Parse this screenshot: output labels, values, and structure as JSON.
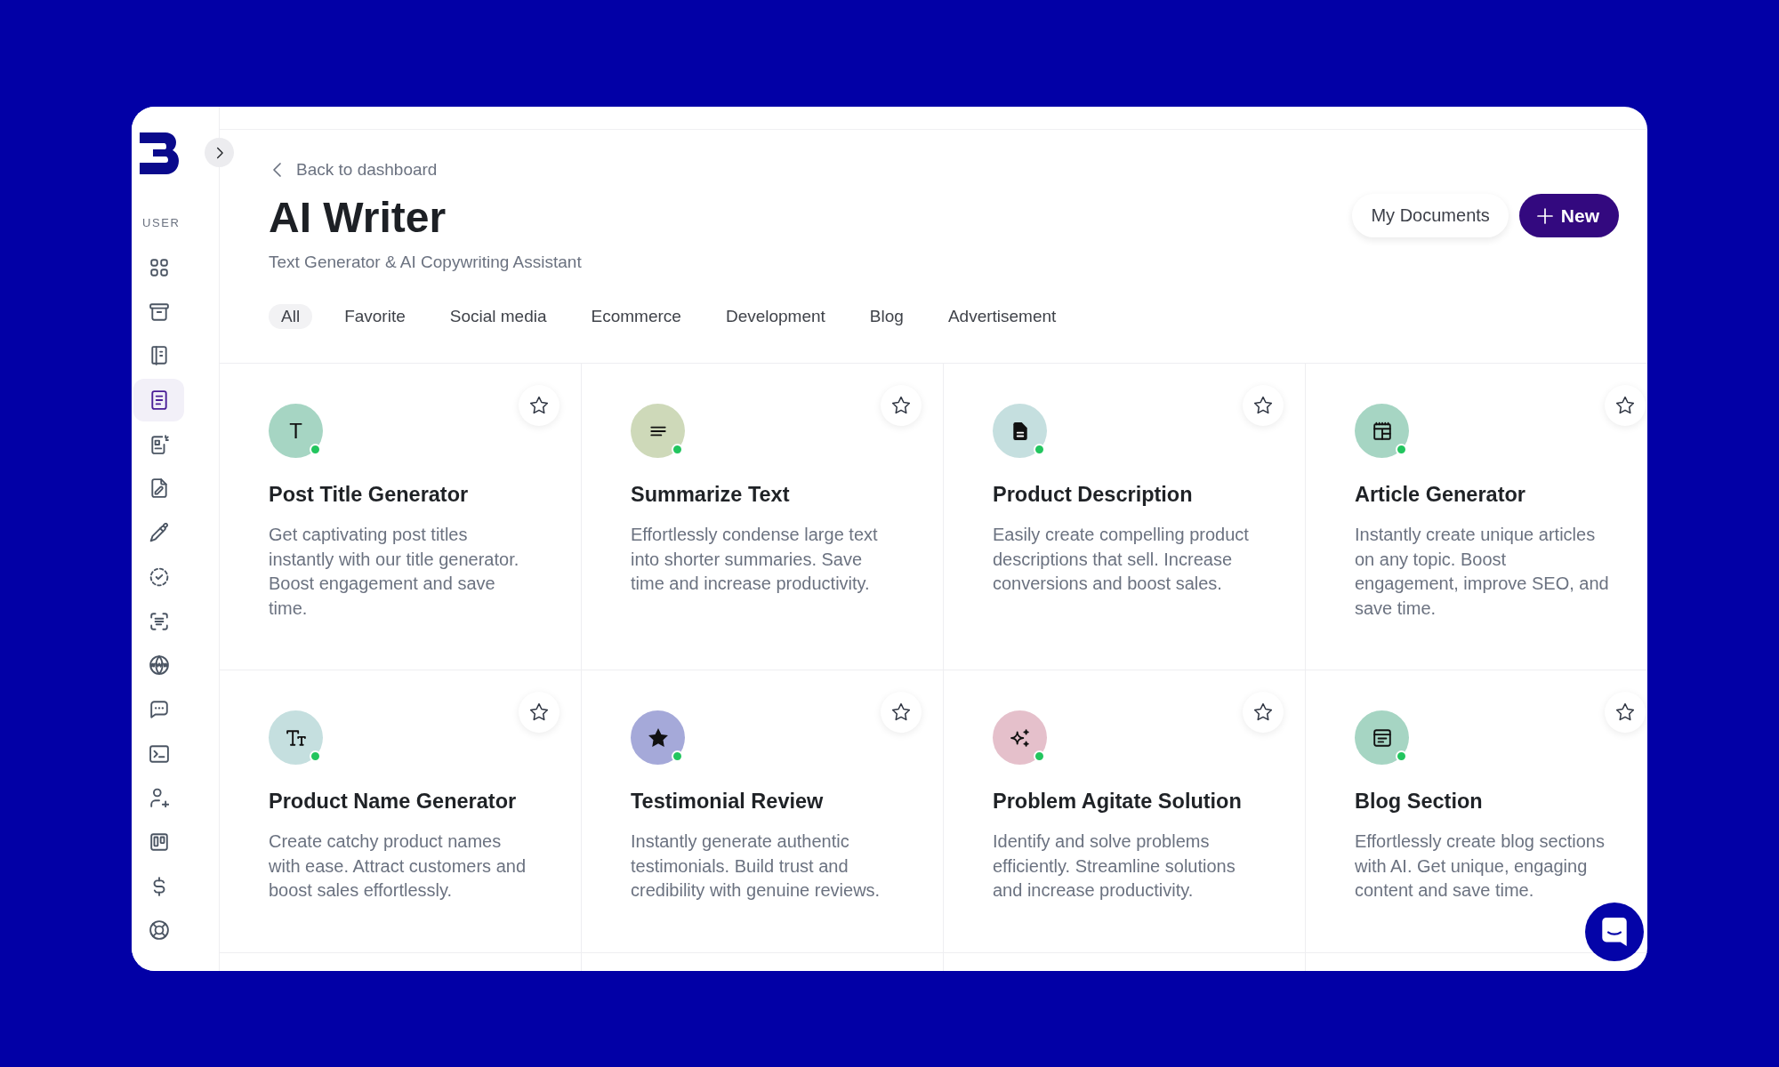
{
  "sidebar": {
    "section_label": "USER",
    "items": [
      {
        "selected": false
      },
      {
        "selected": false
      },
      {
        "selected": false
      },
      {
        "selected": true
      },
      {
        "selected": false
      },
      {
        "selected": false
      },
      {
        "selected": false
      },
      {
        "selected": false
      },
      {
        "selected": false
      },
      {
        "selected": false
      },
      {
        "selected": false
      },
      {
        "selected": false
      },
      {
        "selected": false
      },
      {
        "selected": false
      },
      {
        "selected": false
      },
      {
        "selected": false
      }
    ]
  },
  "header": {
    "back_link": "Back to dashboard",
    "title": "AI Writer",
    "subtitle": "Text Generator & AI Copywriting Assistant",
    "buttons": [
      {
        "kind": "secondary",
        "label": "My Documents"
      },
      {
        "kind": "primary",
        "label": "New"
      }
    ]
  },
  "tabs": [
    {
      "label": "All",
      "selected": true
    },
    {
      "label": "Favorite",
      "selected": false
    },
    {
      "label": "Social media",
      "selected": false
    },
    {
      "label": "Ecommerce",
      "selected": false
    },
    {
      "label": "Development",
      "selected": false
    },
    {
      "label": "Blog",
      "selected": false
    },
    {
      "label": "Advertisement",
      "selected": false
    }
  ],
  "cards": [
    {
      "kind": "letter",
      "glyph": "T",
      "color": "#a6d5c3",
      "title": "Post Title Generator",
      "description": "Get captivating post titles instantly with our title generator. Boost engagement and save time.",
      "favorite": false
    },
    {
      "kind": "icon",
      "color": "#ced9b9",
      "title": "Summarize Text",
      "description": "Effortlessly condense large text into shorter summaries. Save time and increase productivity.",
      "favorite": false
    },
    {
      "kind": "icon",
      "color": "#c5dfdf",
      "title": "Product Description",
      "description": "Easily create compelling product descriptions that sell. Increase conversions and boost sales.",
      "favorite": false
    },
    {
      "kind": "icon",
      "color": "#a6d5c3",
      "title": "Article Generator",
      "description": "Instantly create unique articles on any topic. Boost engagement, improve SEO, and save time.",
      "favorite": false
    },
    {
      "kind": "icon",
      "color": "#c5dfdf",
      "title": "Product Name Generator",
      "description": "Create catchy product names with ease. Attract customers and boost sales effortlessly.",
      "favorite": false
    },
    {
      "kind": "icon",
      "color": "#a5a9d9",
      "title": "Testimonial Review",
      "description": "Instantly generate authentic testimonials. Build trust and credibility with genuine reviews.",
      "favorite": false
    },
    {
      "kind": "icon",
      "color": "#e5c0cb",
      "title": "Problem Agitate Solution",
      "description": "Identify and solve problems efficiently. Streamline solutions and increase productivity.",
      "favorite": false
    },
    {
      "kind": "icon",
      "color": "#a6d5c3",
      "title": "Blog Section",
      "description": "Effortlessly create blog sections with AI. Get unique, engaging content and save time.",
      "favorite": false
    }
  ]
}
